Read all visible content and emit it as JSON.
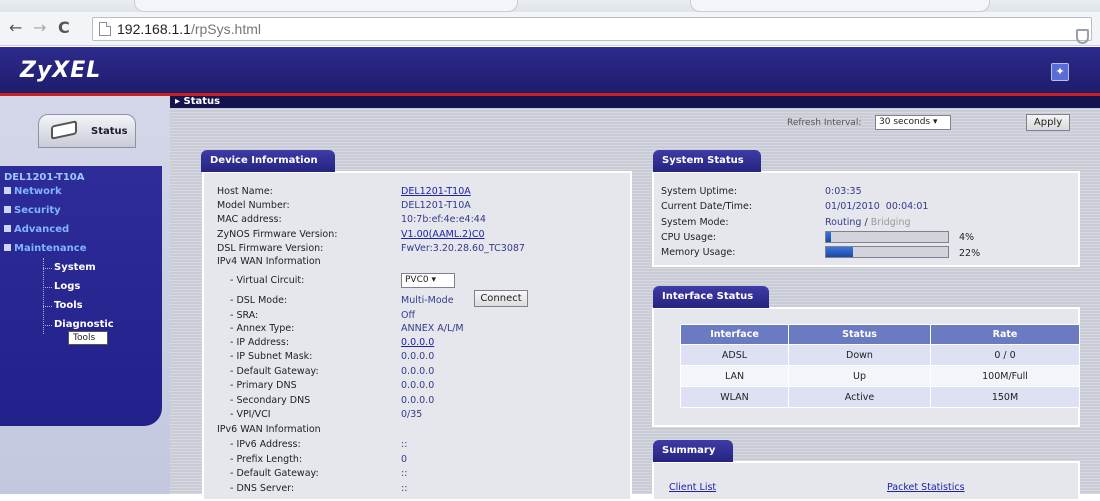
{
  "browser": {
    "url_host": "192.168.1.1",
    "url_path": "/rpSys.html"
  },
  "header": {
    "brand": "ZyXEL"
  },
  "sidebar": {
    "status_tab": "Status",
    "device_name": "DEL1201-T10A",
    "menu": [
      {
        "label": "Network"
      },
      {
        "label": "Security"
      },
      {
        "label": "Advanced"
      },
      {
        "label": "Maintenance"
      }
    ],
    "submenu": [
      {
        "label": "System"
      },
      {
        "label": "Logs"
      },
      {
        "label": "Tools"
      },
      {
        "label": "Diagnostic"
      }
    ],
    "tooltip": "Tools"
  },
  "breadcrumb": "Status",
  "refresh": {
    "label": "Refresh Interval:",
    "value": "30 seconds",
    "apply": "Apply"
  },
  "device_info": {
    "title": "Device Information",
    "rows": [
      {
        "label": "Host Name:",
        "value": "DEL1201-T10A"
      },
      {
        "label": "Model Number:",
        "value": "DEL1201-T10A"
      },
      {
        "label": "MAC address:",
        "value": "10:7b:ef:4e:e4:44"
      },
      {
        "label": "ZyNOS Firmware Version:",
        "value": "V1.00(AAML.2)C0"
      },
      {
        "label": "DSL Firmware Version:",
        "value": "FwVer:3.20.28.60_TC3087"
      }
    ],
    "ipv4_heading": "IPv4 WAN Information",
    "virtual_circuit_label": "- Virtual Circuit:",
    "virtual_circuit_value": "PVC0",
    "dsl_mode_label": "- DSL Mode:",
    "dsl_mode_value": "Multi-Mode",
    "connect_label": "Connect",
    "ipv4_rows": [
      {
        "label": "- SRA:",
        "value": "Off"
      },
      {
        "label": "- Annex Type:",
        "value": "ANNEX A/L/M"
      },
      {
        "label": "- IP Address:",
        "value": "0.0.0.0"
      },
      {
        "label": "- IP Subnet Mask:",
        "value": "0.0.0.0"
      },
      {
        "label": "- Default Gateway:",
        "value": "0.0.0.0"
      },
      {
        "label": "- Primary DNS",
        "value": "0.0.0.0"
      },
      {
        "label": "- Secondary DNS",
        "value": "0.0.0.0"
      },
      {
        "label": "- VPI/VCI",
        "value": "0/35"
      }
    ],
    "ipv6_heading": "IPv6 WAN Information",
    "ipv6_rows": [
      {
        "label": "- IPv6 Address:",
        "value": "::"
      },
      {
        "label": "- Prefix Length:",
        "value": "0"
      },
      {
        "label": "- Default Gateway:",
        "value": "::"
      },
      {
        "label": "- DNS Server:",
        "value": "::"
      }
    ]
  },
  "system_status": {
    "title": "System Status",
    "uptime_label": "System Uptime:",
    "uptime_value": "0:03:35",
    "datetime_label": "Current Date/Time:",
    "datetime_value": "01/01/2010  00:04:01",
    "mode_label": "System Mode:",
    "mode_routing": "Routing",
    "mode_sep": " / ",
    "mode_bridging": "Bridging",
    "cpu_label": "CPU Usage:",
    "cpu_percent": 4,
    "cpu_text": "4%",
    "memory_label": "Memory Usage:",
    "memory_percent": 22,
    "memory_text": "22%"
  },
  "interface_status": {
    "title": "Interface Status",
    "headers": [
      "Interface",
      "Status",
      "Rate"
    ],
    "rows": [
      [
        "ADSL",
        "Down",
        "0 / 0"
      ],
      [
        "LAN",
        "Up",
        "100M/Full"
      ],
      [
        "WLAN",
        "Active",
        "150M"
      ]
    ]
  },
  "summary": {
    "title": "Summary",
    "client_list": "Client List",
    "packet_statistics": "Packet Statistics"
  }
}
